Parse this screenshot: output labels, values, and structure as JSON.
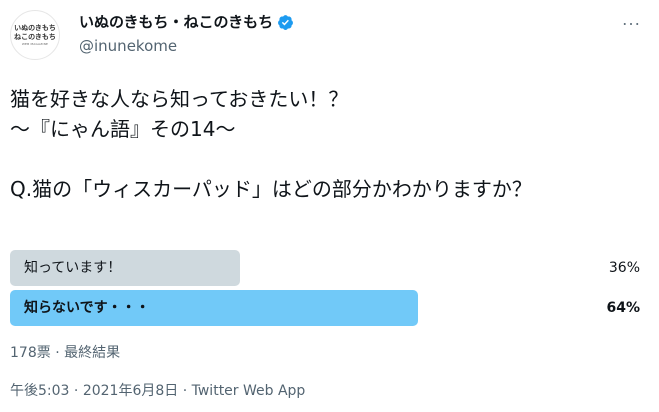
{
  "account": {
    "avatar_line1": "いぬのきもち",
    "avatar_line2": "ねこのきもち",
    "avatar_line3": "WEB MAGAZINE",
    "display_name": "いぬのきもち・ねこのきもち",
    "handle": "@inunekome"
  },
  "tweet": {
    "line1": "猫を好きな人なら知っておきたい！？",
    "line2": "〜『にゃん語』その14〜",
    "line3": "Q.猫の「ウィスカーパッド」はどの部分かわかりますか？"
  },
  "poll": {
    "options": [
      {
        "label": "知っています！",
        "percent": "36%",
        "value": 0.36
      },
      {
        "label": "知らないです・・・",
        "percent": "64%",
        "value": 0.64
      }
    ],
    "votes_text": "178票",
    "status_text": "最終結果"
  },
  "footer": {
    "time": "午後5:03",
    "date": "2021年6月8日",
    "source": "Twitter Web App"
  },
  "colors": {
    "verified": "#1d9bf0",
    "winner_bar": "#71c9f8",
    "loser_bar": "#cfd9de",
    "secondary_text": "#536471"
  }
}
